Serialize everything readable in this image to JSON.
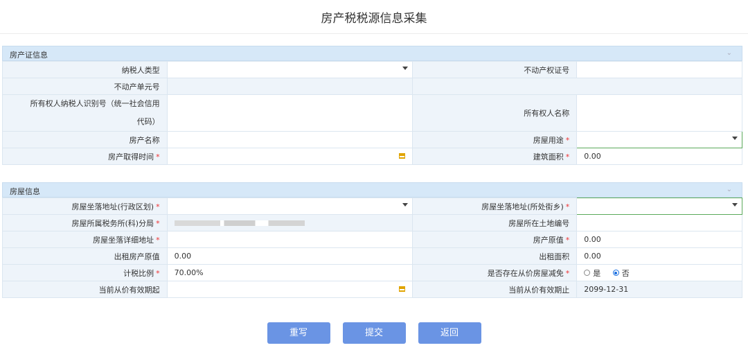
{
  "title": "房产税税源信息采集",
  "section1": {
    "title": "房产证信息",
    "rows": {
      "taxpayer_type_label": "纳税人类型",
      "property_cert_label": "不动产权证号",
      "unit_no_label": "不动产单元号",
      "owner_id_label_1": "所有权人纳税人识别号（统一社会信用",
      "owner_id_label_2": "代码）",
      "owner_name_label": "所有权人名称",
      "property_name_label": "房产名称",
      "usage_label": "房屋用途",
      "acquire_time_label": "房产取得时间",
      "area_label": "建筑面积",
      "area_value": "0.00"
    }
  },
  "section2": {
    "title": "房屋信息",
    "rows": {
      "district_label": "房屋坐落地址(行政区划)",
      "street_label": "房屋坐落地址(所处街乡)",
      "tax_bureau_label": "房屋所属税务所(科)分局",
      "land_no_label": "房屋所在土地编号",
      "detail_addr_label": "房屋坐落详细地址",
      "orig_value_label": "房产原值",
      "orig_value": "0.00",
      "rent_orig_label": "出租房产原值",
      "rent_orig_value": "0.00",
      "rent_area_label": "出租面积",
      "rent_area_value": "0.00",
      "tax_ratio_label": "计税比例",
      "tax_ratio_value": "70.00%",
      "relief_label": "是否存在从价房屋减免",
      "relief_yes": "是",
      "relief_no": "否",
      "relief_selected": "否",
      "valid_from_label": "当前从价有效期起",
      "valid_to_label": "当前从价有效期止",
      "valid_to_value": "2099-12-31"
    }
  },
  "buttons": {
    "reset": "重写",
    "submit": "提交",
    "back": "返回"
  },
  "colors": {
    "header_bg": "#d6e8f8",
    "label_bg": "#eef4fa",
    "button": "#6a94e4",
    "required": "#e33"
  }
}
